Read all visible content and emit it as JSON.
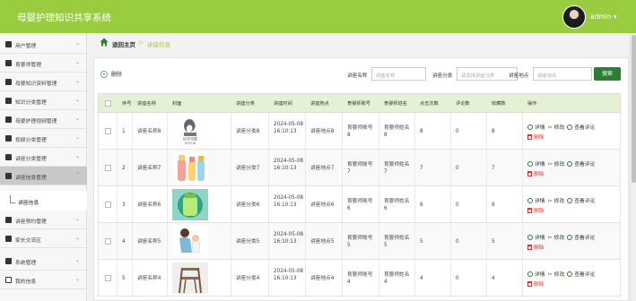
{
  "header": {
    "app_title": "母婴护理知识共享系统",
    "user": "admin ▾"
  },
  "sidebar": {
    "items": [
      {
        "label": "用户管理"
      },
      {
        "label": "育婴师管理"
      },
      {
        "label": "母婴知识资料管理"
      },
      {
        "label": "知识分类管理"
      },
      {
        "label": "母婴护理视频管理"
      },
      {
        "label": "视频分类管理"
      },
      {
        "label": "讲座分类管理"
      },
      {
        "label": "讲座信息管理"
      },
      {
        "label": "讲座预约管理"
      },
      {
        "label": "家长交流区"
      },
      {
        "label": "系统管理"
      },
      {
        "label": "我的信息"
      }
    ],
    "subitem": {
      "label": "讲座信息"
    }
  },
  "breadcrumb": {
    "home": "退回主页",
    "separator": "▷",
    "current": "讲座信息"
  },
  "toolbar": {
    "delete_label": "删除",
    "name_label": "讲座名称",
    "name_placeholder": "讲座名称",
    "category_label": "讲座分类",
    "category_placeholder": "请选择讲座分类",
    "location_label": "讲座地点",
    "location_placeholder": "讲座地点",
    "search_label": "搜索"
  },
  "table": {
    "columns": [
      "序号",
      "讲座名称",
      "封面",
      "讲座分类",
      "讲座时间",
      "讲座地点",
      "育婴师账号",
      "育婴师姓名",
      "点击次数",
      "评论数",
      "收藏数",
      "操作"
    ],
    "actions": {
      "detail": "详情",
      "edit": "修改",
      "comments": "查看评论",
      "delete": "删除"
    },
    "rows": [
      {
        "no": "1",
        "name": "讲座名称8",
        "category": "讲座分类8",
        "time": "2024-05-08 16:10:13",
        "location": "讲座地点8",
        "account": "育婴师账号8",
        "teacher": "育婴师姓名8",
        "clicks": "8",
        "comments": "0",
        "favorites": "8",
        "cover": "logo-book",
        "cover_text": "好孕母婴"
      },
      {
        "no": "2",
        "name": "讲座名称7",
        "category": "讲座分类7",
        "time": "2024-05-08 16:10:13",
        "location": "讲座地点7",
        "account": "育婴师账号7",
        "teacher": "育婴师姓名7",
        "clicks": "7",
        "comments": "0",
        "favorites": "7",
        "cover": "bottles"
      },
      {
        "no": "3",
        "name": "讲座名称6",
        "category": "讲座分类6",
        "time": "2024-05-08 16:10:13",
        "location": "讲座地点6",
        "account": "育婴师账号6",
        "teacher": "育婴师姓名6",
        "clicks": "6",
        "comments": "0",
        "favorites": "6",
        "cover": "cup"
      },
      {
        "no": "4",
        "name": "讲座名称5",
        "category": "讲座分类5",
        "time": "2024-05-08 16:10:13",
        "location": "讲座地点5",
        "account": "育婴师账号5",
        "teacher": "育婴师姓名5",
        "clicks": "5",
        "comments": "0",
        "favorites": "5",
        "cover": "mother-baby"
      },
      {
        "no": "5",
        "name": "讲座名称4",
        "category": "讲座分类4",
        "time": "2024-05-08 16:10:13",
        "location": "讲座地点4",
        "account": "育婴师账号4",
        "teacher": "育婴师姓名4",
        "clicks": "4",
        "comments": "0",
        "favorites": "4",
        "cover": "high-chair"
      }
    ]
  },
  "colors": {
    "topbar": "#9acc3f",
    "accent": "#2e7d32",
    "header_row": "#e6f0d5",
    "danger": "#dd3333"
  }
}
